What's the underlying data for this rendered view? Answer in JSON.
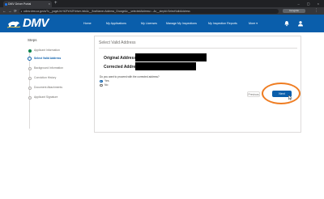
{
  "browser": {
    "tab_title": "DMV Driver Portal",
    "tab_close": "×",
    "new_tab": "+",
    "window_controls": "–  ▢  ×",
    "back": "←",
    "forward": "→",
    "reload": "⟳",
    "url": "cdlmv.dmv.ca.gov/s/?c__pageUrl=%2Fs%2Fdriver-info&c__flowName=Address_Change&c__selectedAddress=...&c__stepId=SelectValidAddress",
    "incognito_label": "Incognito",
    "menu": "⋮"
  },
  "header": {
    "logo_text": "DMV",
    "nav": [
      "Home",
      "My Applications",
      "My Licenses",
      "Manage My Inspections",
      "My Inspection Reports",
      "More"
    ],
    "more_caret": "▾",
    "icons": [
      "bell-icon",
      "user-icon"
    ]
  },
  "steps": {
    "title": "Steps",
    "items": [
      {
        "label": "Applicant Information",
        "state": "done"
      },
      {
        "label": "Select Valid Address",
        "state": "active"
      },
      {
        "label": "Background Information",
        "state": "pending"
      },
      {
        "label": "Conviction History",
        "state": "pending"
      },
      {
        "label": "Document Attachments",
        "state": "pending"
      },
      {
        "label": "Applicant Signature",
        "state": "pending"
      }
    ]
  },
  "main": {
    "section_title": "Select Valid Address",
    "original_label": "Original Address",
    "corrected_label": "Corrected Address",
    "question": "Do you want to proceed with the corrected address?",
    "options": [
      {
        "label": "Yes",
        "selected": true
      },
      {
        "label": "No",
        "selected": false
      }
    ],
    "previous_label": "Previous",
    "next_label": "Next"
  },
  "colors": {
    "brand_blue": "#0a5eab",
    "highlight": "#ef7d22",
    "done_green": "#04844b"
  }
}
